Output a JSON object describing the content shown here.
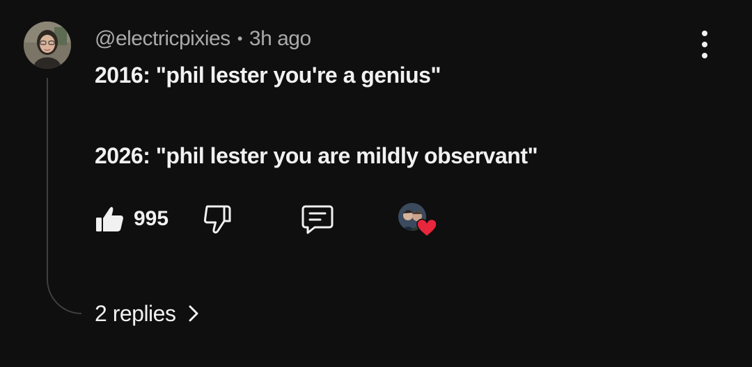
{
  "comment": {
    "author": "@electricpixies",
    "separator": "•",
    "time": "3h ago",
    "lines": [
      "2016: \"phil lester you're a genius\"",
      "2026: \"phil lester you are mildly observant\""
    ],
    "like_count": "995",
    "replies_label": "2 replies"
  },
  "icons": {
    "more": "more-vertical-icon",
    "like": "thumbs-up-filled-icon",
    "dislike": "thumbs-down-outline-icon",
    "reply": "reply-comment-icon",
    "heart": "creator-heart-icon",
    "chevron": "chevron-right-icon"
  },
  "colors": {
    "background": "#0f0f0f",
    "text": "#f1f1f1",
    "secondary_text": "#aaaaaa",
    "thread_line": "#3f3f3f",
    "heart": "#e8263c"
  }
}
